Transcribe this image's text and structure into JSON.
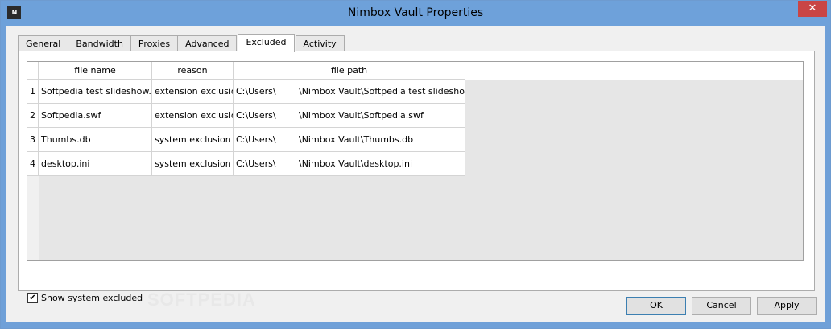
{
  "window": {
    "title": "Nimbox Vault Properties",
    "app_icon": "N"
  },
  "tabs": [
    {
      "label": "General"
    },
    {
      "label": "Bandwidth"
    },
    {
      "label": "Proxies"
    },
    {
      "label": "Advanced"
    },
    {
      "label": "Excluded",
      "active": true
    },
    {
      "label": "Activity"
    }
  ],
  "table": {
    "headers": [
      "file name",
      "reason",
      "file path"
    ],
    "rows": [
      {
        "num": "1",
        "name": "Softpedia test slideshow.flv",
        "reason": "extension exclusion",
        "path_a": "C:\\Users\\",
        "path_b": "\\Nimbox Vault\\Softpedia test slideshow.flv"
      },
      {
        "num": "2",
        "name": "Softpedia.swf",
        "reason": "extension exclusion",
        "path_a": "C:\\Users\\",
        "path_b": "\\Nimbox Vault\\Softpedia.swf"
      },
      {
        "num": "3",
        "name": "Thumbs.db",
        "reason": "system exclusion",
        "path_a": "C:\\Users\\",
        "path_b": "\\Nimbox Vault\\Thumbs.db"
      },
      {
        "num": "4",
        "name": "desktop.ini",
        "reason": "system exclusion",
        "path_a": "C:\\Users\\",
        "path_b": "\\Nimbox Vault\\desktop.ini"
      }
    ]
  },
  "show_system_excluded": {
    "label": "Show system excluded",
    "checked": true,
    "mark": "✔"
  },
  "watermark": "SOFTPEDIA",
  "buttons": {
    "ok": "OK",
    "cancel": "Cancel",
    "apply": "Apply"
  },
  "close_glyph": "✕"
}
